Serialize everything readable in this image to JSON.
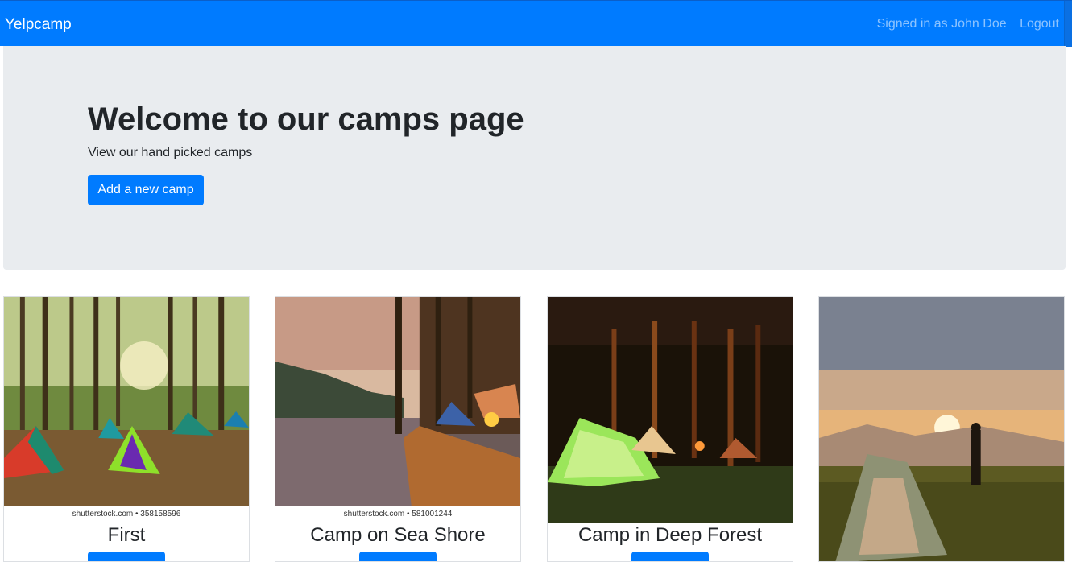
{
  "nav": {
    "brand": "Yelpcamp",
    "user": "Signed in as John Doe",
    "logout": "Logout"
  },
  "hero": {
    "title": "Welcome to our camps page",
    "subtitle": "View our hand picked camps",
    "button": "Add a new camp"
  },
  "camps": [
    {
      "caption": "shutterstock.com • 358158596",
      "title": "First"
    },
    {
      "caption": "shutterstock.com • 581001244",
      "title": "Camp on Sea Shore"
    },
    {
      "caption": "",
      "title": "Camp in Deep Forest"
    },
    {
      "caption": "",
      "title": ""
    }
  ],
  "colors": {
    "primary": "#007bff",
    "jumbotron": "#e9ecef"
  }
}
